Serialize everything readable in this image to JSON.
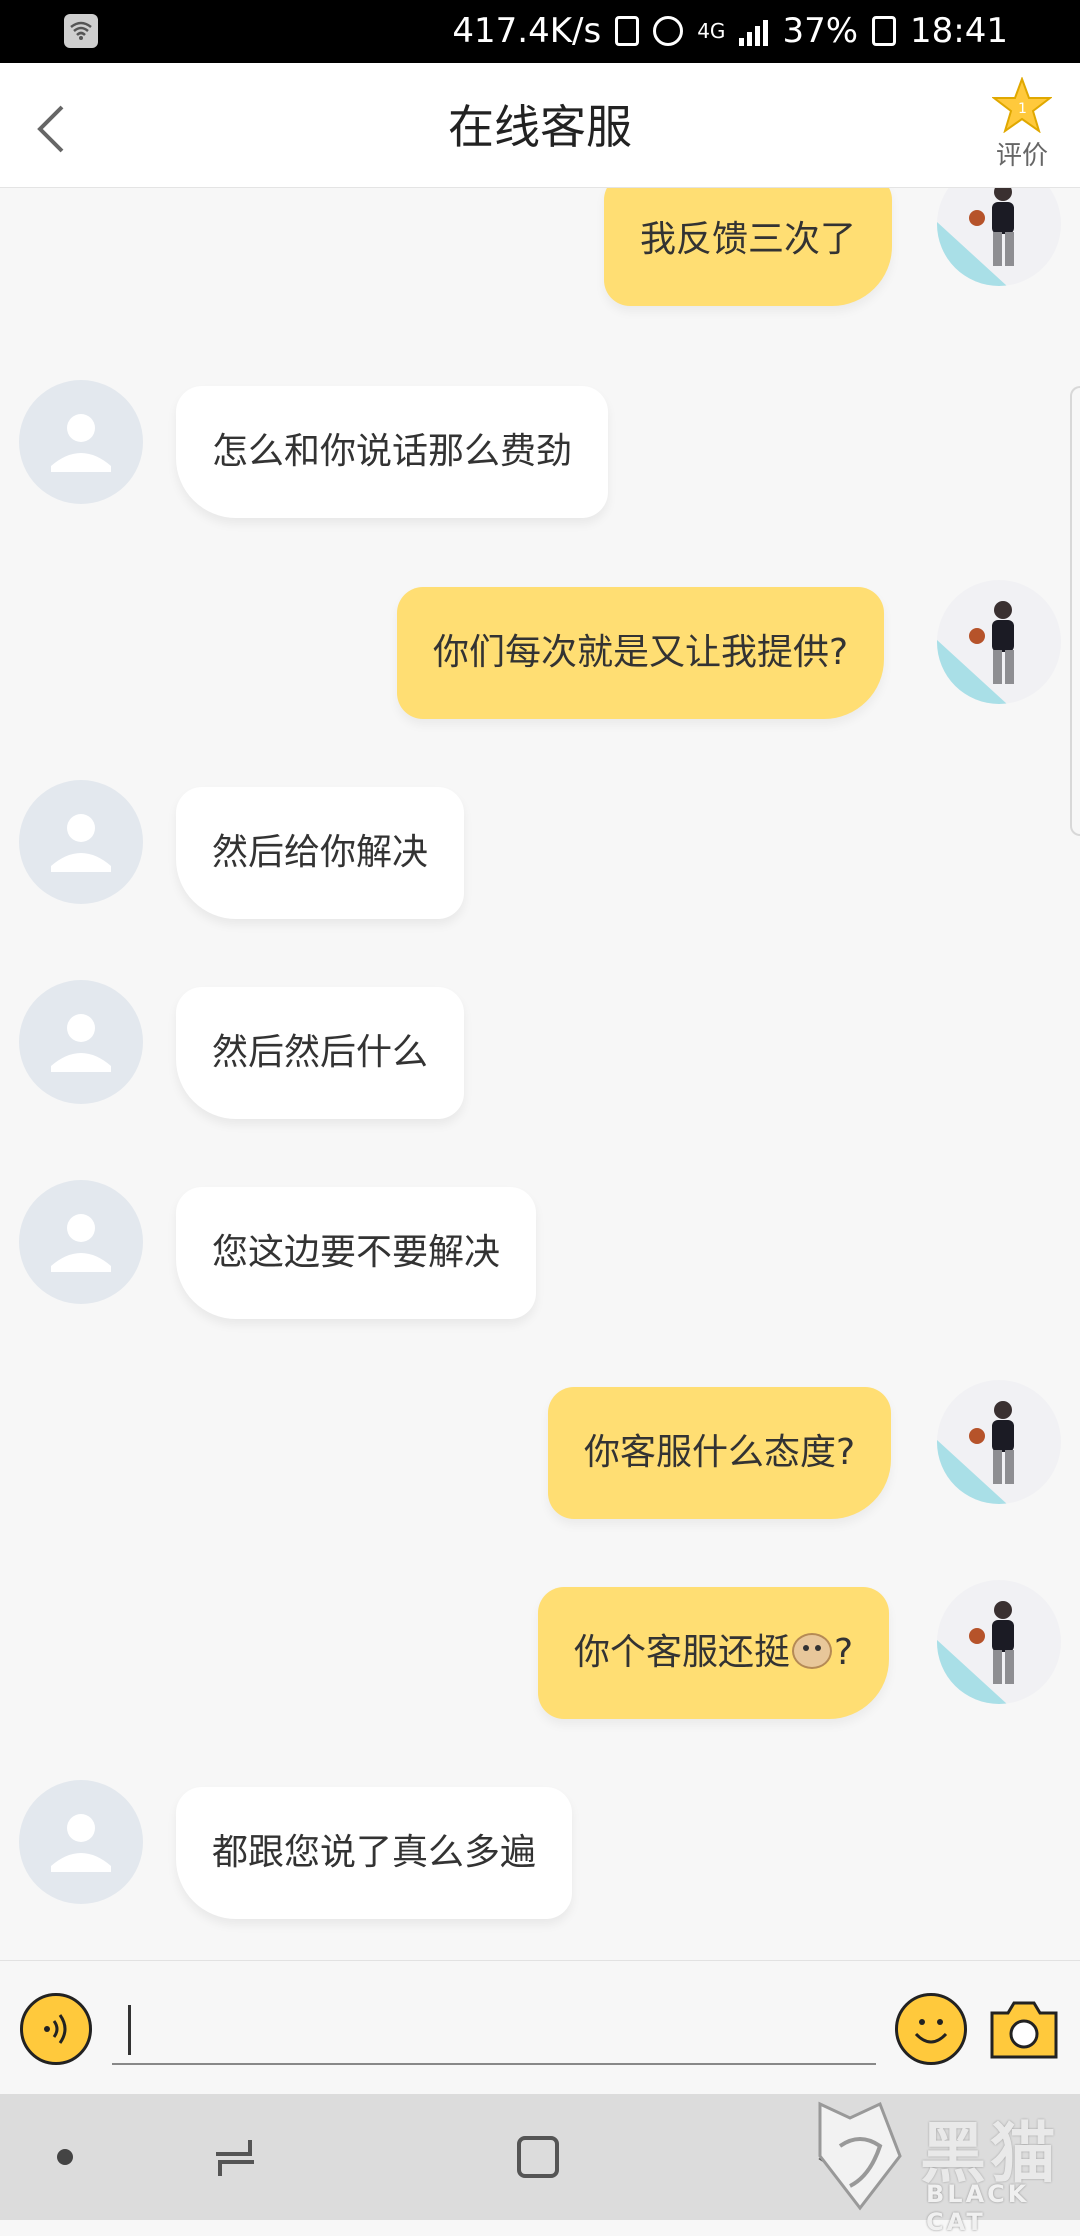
{
  "status_bar": {
    "speed": "417.4K/s",
    "network": "4G",
    "battery": "37%",
    "time": "18:41"
  },
  "header": {
    "title": "在线客服",
    "rate_label": "评价"
  },
  "messages": [
    {
      "from": "user",
      "text": "我反馈三次了"
    },
    {
      "from": "agent",
      "text": "怎么和你说话那么费劲"
    },
    {
      "from": "user",
      "text": "你们每次就是又让我提供?"
    },
    {
      "from": "agent",
      "text": "然后给你解决"
    },
    {
      "from": "agent",
      "text": "然后然后什么"
    },
    {
      "from": "agent",
      "text": "您这边要不要解决"
    },
    {
      "from": "user",
      "text": "你客服什么态度?"
    },
    {
      "from": "user",
      "text_before": "你个客服还挺",
      "emoji": "cow-emoji",
      "text_after": "?"
    },
    {
      "from": "agent",
      "text": "都跟您说了真么多遍"
    }
  ],
  "composer": {
    "input_value": "",
    "placeholder": ""
  },
  "watermark": {
    "brand": "黑猫",
    "brand_en": "BLACK CAT"
  },
  "colors": {
    "accent": "#ffc93c",
    "user_bubble": "#ffde73",
    "agent_bubble": "#ffffff"
  }
}
